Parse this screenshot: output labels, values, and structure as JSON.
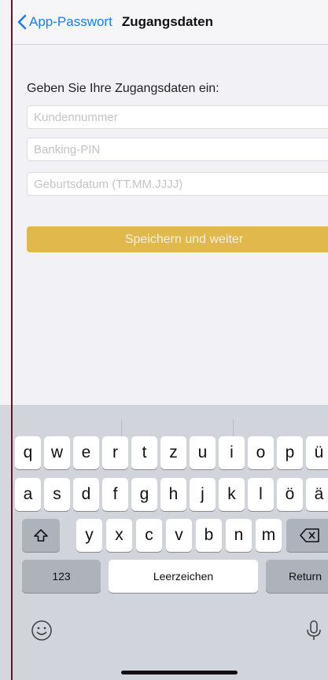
{
  "nav": {
    "back_label": "App-Passwort",
    "title": "Zugangsdaten"
  },
  "form": {
    "prompt": "Geben Sie Ihre Zugangsdaten ein:",
    "customer_number_placeholder": "Kundennummer",
    "pin_placeholder": "Banking-PIN",
    "birthdate_placeholder": "Geburtsdatum (TT.MM.JJJJ)",
    "save_label": "Speichern und weiter"
  },
  "keyboard": {
    "row1": [
      "q",
      "w",
      "e",
      "r",
      "t",
      "z",
      "u",
      "i",
      "o",
      "p",
      "ü"
    ],
    "row2": [
      "a",
      "s",
      "d",
      "f",
      "g",
      "h",
      "j",
      "k",
      "l",
      "ö",
      "ä"
    ],
    "row3": [
      "y",
      "x",
      "c",
      "v",
      "b",
      "n",
      "m"
    ],
    "numbers_label": "123",
    "space_label": "Leerzeichen",
    "return_label": "Return"
  },
  "colors": {
    "accent": "#1a7cf2",
    "button": "#e0b84c"
  }
}
